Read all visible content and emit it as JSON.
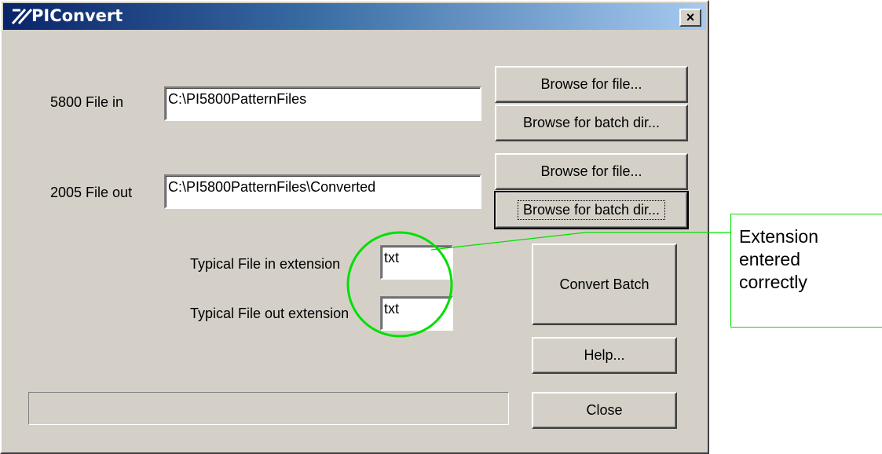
{
  "window": {
    "title": "PIConvert",
    "close_glyph": "×"
  },
  "form": {
    "file_in_label": "5800 File in",
    "file_in_value": "C:\\PI5800PatternFiles",
    "file_out_label": "2005 File out",
    "file_out_value": "C:\\PI5800PatternFiles\\Converted",
    "in_ext_label": "Typical File in extension",
    "in_ext_value": "txt",
    "out_ext_label": "Typical File out extension",
    "out_ext_value": "txt"
  },
  "buttons": {
    "browse_file_in": "Browse for file...",
    "browse_batch_in": "Browse for batch dir...",
    "browse_file_out": "Browse for file...",
    "browse_batch_out": "Browse for batch dir...",
    "convert_batch": "Convert Batch",
    "help": "Help...",
    "close": "Close"
  },
  "progress": {
    "value": 0
  },
  "annotation": {
    "text": "Extension\nentered\ncorrectly",
    "color": "#00e000"
  },
  "icons": {
    "app": "app-icon",
    "close": "close-icon"
  }
}
